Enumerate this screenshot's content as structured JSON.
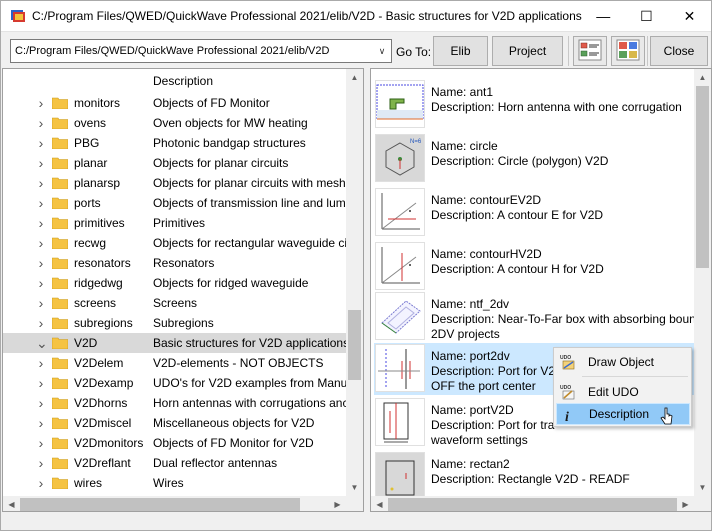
{
  "window": {
    "title": "C:/Program Files/QWED/QuickWave Professional 2021/elib/V2D - Basic structures for V2D applications",
    "minimize_glyph": "—",
    "maximize_glyph": "☐",
    "close_glyph": "✕"
  },
  "toolbar": {
    "path_value": "C:/Program Files/QWED/QuickWave Professional 2021/elib/V2D",
    "goto_label": "Go To:",
    "elib_label": "Elib",
    "project_label": "Project",
    "close_label": "Close",
    "dropdown_glyph": "∨"
  },
  "tree": {
    "column_header": "Description",
    "rows": [
      {
        "name": "monitors",
        "desc": "Objects of FD Monitor",
        "expanded": false
      },
      {
        "name": "ovens",
        "desc": "Oven objects for MW heating",
        "expanded": false
      },
      {
        "name": "PBG",
        "desc": "Photonic bandgap structures",
        "expanded": false
      },
      {
        "name": "planar",
        "desc": "Objects for planar circuits",
        "expanded": false
      },
      {
        "name": "planarsp",
        "desc": "Objects for planar circuits with mesh",
        "expanded": false
      },
      {
        "name": "ports",
        "desc": "Objects of transmission line and lum",
        "expanded": false
      },
      {
        "name": "primitives",
        "desc": "Primitives",
        "expanded": false
      },
      {
        "name": "recwg",
        "desc": "Objects for rectangular waveguide ci",
        "expanded": false
      },
      {
        "name": "resonators",
        "desc": "Resonators",
        "expanded": false
      },
      {
        "name": "ridgedwg",
        "desc": "Objects for ridged waveguide",
        "expanded": false
      },
      {
        "name": "screens",
        "desc": "Screens",
        "expanded": false
      },
      {
        "name": "subregions",
        "desc": "Subregions",
        "expanded": false
      },
      {
        "name": "V2D",
        "desc": "Basic structures for V2D applications",
        "expanded": true,
        "selected": true
      },
      {
        "name": "V2Delem",
        "desc": "V2D-elements - NOT OBJECTS",
        "expanded": false
      },
      {
        "name": "V2Dexamp",
        "desc": "UDO's for V2D examples from Manua",
        "expanded": false
      },
      {
        "name": "V2Dhorns",
        "desc": "Horn antennas with corrugations anc",
        "expanded": false
      },
      {
        "name": "V2Dmiscel",
        "desc": "Miscellaneous objects for V2D",
        "expanded": false
      },
      {
        "name": "V2Dmonitors",
        "desc": "Objects of FD Monitor for V2D",
        "expanded": false
      },
      {
        "name": "V2Dreflant",
        "desc": "Dual reflector antennas",
        "expanded": false
      },
      {
        "name": "wires",
        "desc": " Wires",
        "expanded": false
      }
    ]
  },
  "items": [
    {
      "name": "Name: ant1",
      "desc": "Description: Horn antenna with one corrugation",
      "desc2": "",
      "thumb": "horn-thumbnail"
    },
    {
      "name": "Name: circle",
      "desc": "Description: Circle (polygon) V2D",
      "desc2": "",
      "thumb": "polygon-thumbnail",
      "thumb_text": "N=6"
    },
    {
      "name": "Name: contourEV2D",
      "desc": "Description: A contour E for V2D",
      "desc2": "",
      "thumb": "axes-thumbnail"
    },
    {
      "name": "Name: contourHV2D",
      "desc": "Description: A contour H for V2D",
      "desc2": "",
      "thumb": "axes-thumbnail"
    },
    {
      "name": "Name: ntf_2dv",
      "desc": "Description: Near-To-Far box with absorbing boun",
      "desc2": "2DV projects",
      "thumb": "box-thumbnail"
    },
    {
      "name": "Name: port2dv",
      "desc": "Description: Port for V2",
      "desc2": "OFF the port center",
      "thumb": "port-thumbnail",
      "selected": true
    },
    {
      "name": "Name: portV2D",
      "desc": "Description: Port for tra",
      "desc2": "waveform settings",
      "thumb": "port-thumbnail"
    },
    {
      "name": "Name: rectan2",
      "desc": "Description: Rectangle V2D - READF",
      "desc2": "",
      "thumb": "rect-thumbnail"
    }
  ],
  "context_menu": {
    "items": [
      {
        "label": "Draw Object",
        "icon": "draw-object-icon",
        "badge": "UDO"
      },
      {
        "label": "Edit UDO",
        "icon": "edit-udo-icon",
        "badge": "UDO"
      },
      {
        "label": "Description",
        "icon": "info-icon",
        "glyph": "i"
      }
    ]
  },
  "colors": {
    "selection": "#cce8ff",
    "tree_selection": "#d9d9d9",
    "menu_highlight": "#91c9f7",
    "folder": "#f5c342"
  }
}
